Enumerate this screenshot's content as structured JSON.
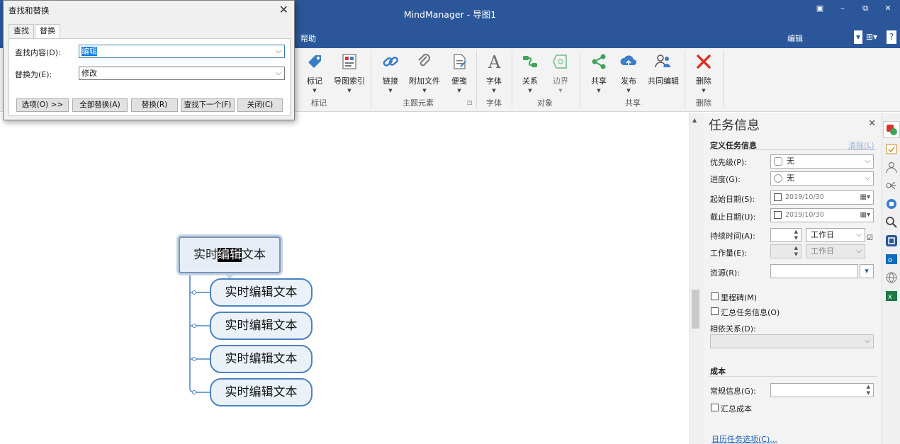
{
  "window": {
    "title": "MindManager - 导图1",
    "controls": {
      "ribbon_options": "▣",
      "minimize": "–",
      "restore": "⧉",
      "close": "✕"
    }
  },
  "ribbon_tabs": {
    "help": "帮助",
    "edit": "编辑"
  },
  "ribbon": {
    "buttons": {
      "marker": "标记",
      "map_index": "导图索引",
      "link": "链接",
      "attach_file": "附加文件",
      "note": "便笺",
      "font": "字体",
      "relationship": "关系",
      "boundary": "边界",
      "share": "共享",
      "publish": "发布",
      "co_edit": "共同编辑",
      "delete": "删除"
    },
    "groups": {
      "marker": "标记",
      "topic_elements": "主题元素",
      "font": "字体",
      "objects": "对象",
      "share": "共享",
      "delete": "删除"
    }
  },
  "map": {
    "central_topic": {
      "before": "实时",
      "highlight": "编辑",
      "after": "文本"
    },
    "subtopics": [
      "实时编辑文本",
      "实时编辑文本",
      "实时编辑文本",
      "实时编辑文本"
    ]
  },
  "find_dialog": {
    "title": "查找和替换",
    "tabs": [
      "查找",
      "替换"
    ],
    "find_label": "查找内容(D):",
    "find_value": "编辑",
    "replace_label": "替换为(E):",
    "replace_value": "修改",
    "buttons": {
      "options": "选项(O) >>",
      "replace_all": "全部替换(A)",
      "replace": "替换(R)",
      "find_next": "查找下一个(F)",
      "close": "关闭(C)"
    }
  },
  "task_pane": {
    "title": "任务信息",
    "section_define": "定义任务信息",
    "clear": "清除(L)",
    "priority_label": "优先级(P):",
    "priority_value": "无",
    "progress_label": "进度(G):",
    "progress_value": "无",
    "start_label": "起始日期(S):",
    "start_value": "2019/10/30",
    "due_label": "截止日期(U):",
    "due_value": "2019/10/30",
    "duration_label": "持续时间(A):",
    "duration_unit": "工作日",
    "effort_label": "工作量(E):",
    "effort_unit": "工作日",
    "resources_label": "资源(R):",
    "milestone": "里程碑(M)",
    "rollup_task": "汇总任务信息(O)",
    "dependencies_label": "相依关系(D):",
    "section_cost": "成本",
    "general_label": "常规信息(G):",
    "rollup_cost": "汇总成本",
    "calendar_options": "日历任务选项(C)..."
  },
  "colors": {
    "titlebar": "#2b579a",
    "topic_border": "#4a82c2",
    "topic_fill": "#eaf1f8",
    "delete_red": "#d9342b",
    "share_green": "#3fa35b"
  }
}
